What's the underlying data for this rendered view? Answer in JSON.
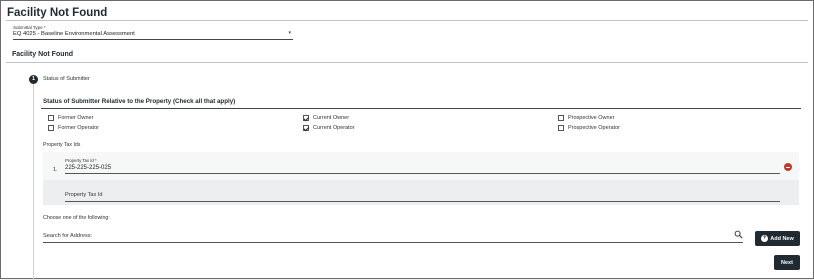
{
  "page": {
    "title": "Facility Not Found"
  },
  "submittal": {
    "label": "Submittal Type *",
    "value": "EQ 4025 - Baseline Environmental Assessment"
  },
  "section": {
    "title": "Facility Not Found"
  },
  "step": {
    "number": "1",
    "label": "Status of Submitter"
  },
  "status": {
    "heading": "Status of Submitter Relative to the Property (Check all that apply)",
    "options": [
      {
        "label": "Former Owner",
        "checked": false
      },
      {
        "label": "Current Owner",
        "checked": true
      },
      {
        "label": "Prospective Owner",
        "checked": false
      },
      {
        "label": "Former Operator",
        "checked": false
      },
      {
        "label": "Current Operator",
        "checked": true
      },
      {
        "label": "Prospective Operator",
        "checked": false
      }
    ]
  },
  "property_tax": {
    "label": "Property Tax Ids",
    "rows": [
      {
        "number": "1.",
        "field_label": "Property Tax Id *",
        "value": "225-225-225-025"
      }
    ],
    "new_placeholder": "Property Tax Id"
  },
  "address": {
    "choose_label": "Choose one of the following:",
    "search_placeholder": "Search for Address:",
    "add_new_label": "Add New"
  },
  "actions": {
    "next_label": "Next"
  },
  "colors": {
    "primary": "#1f2a33",
    "remove": "#c0392b"
  }
}
